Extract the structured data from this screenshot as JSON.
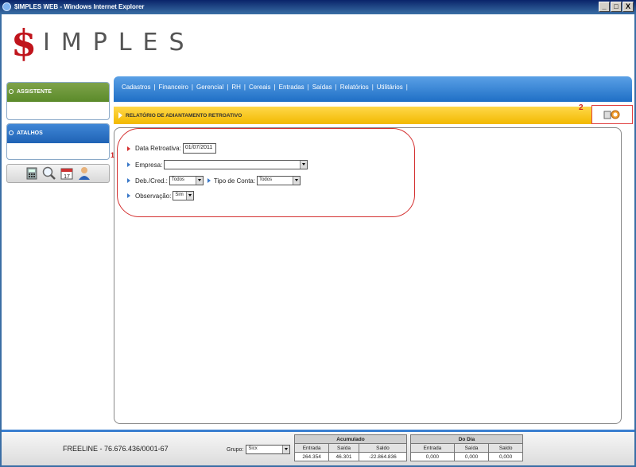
{
  "window": {
    "title": "$IMPLES WEB - Windows Internet Explorer",
    "buttons": [
      "_",
      "□",
      "X"
    ]
  },
  "logo": {
    "symbol": "$",
    "text": "IMPLES",
    "symbol_color": "#c0141c"
  },
  "sidebar": {
    "assistente": "ASSISTENTE",
    "atalhos": "ATALHOS",
    "tools": [
      "calculator-icon",
      "search-icon",
      "calendar-icon",
      "user-icon"
    ],
    "assistente_color": "#5b8a2a",
    "atalhos_color": "#1f63b5"
  },
  "nav": {
    "items": [
      "Cadastros",
      "Financeiro",
      "Gerencial",
      "RH",
      "Cereais",
      "Entradas",
      "Saídas",
      "Relatórios",
      "Utilitários"
    ],
    "separator": "|",
    "color": "#1f6fc6"
  },
  "section": {
    "title": "RELATÓRIO DE ADIANTAMENTO RETROATIVO",
    "marker_1": "1",
    "marker_2": "2",
    "accent": "#f2b900"
  },
  "form": {
    "data_retroativa_label": "Data Retroativa:",
    "data_retroativa_value": "01/07/2011",
    "empresa_label": "Empresa:",
    "empresa_value": "",
    "deb_cred_label": "Deb./Cred.:",
    "deb_cred_value": "Todos",
    "tipo_conta_label": "Tipo de Conta:",
    "tipo_conta_value": "Todos",
    "observacao_label": "Observação:",
    "observacao_value": "Sim"
  },
  "footer": {
    "freeline": "FREELINE - 76.676.436/0001-67",
    "grupo_label": "Grupo:",
    "grupo_value": "Sicx",
    "acumulado": {
      "title": "Acumulado",
      "headers": [
        "Entrada",
        "Saída",
        "Saldo"
      ],
      "values": [
        "264.354",
        "46.301",
        "-22.864.836"
      ]
    },
    "do_dia": {
      "title": "Do Dia",
      "headers": [
        "Entrada",
        "Saída",
        "Saldo"
      ],
      "values": [
        "0,000",
        "0,000",
        "0,000"
      ]
    }
  }
}
